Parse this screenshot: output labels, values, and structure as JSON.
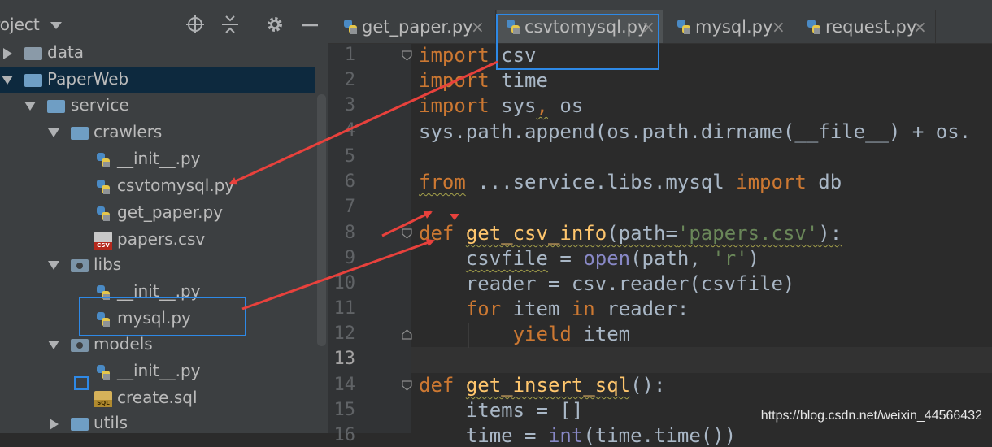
{
  "project": {
    "title": "roject",
    "tree": [
      {
        "label": "data",
        "type": "folder-data",
        "depth": 0,
        "expanded": false
      },
      {
        "label": "PaperWeb",
        "type": "folder",
        "depth": 0,
        "expanded": true,
        "selected": true
      },
      {
        "label": "service",
        "type": "folder",
        "depth": 1,
        "expanded": true
      },
      {
        "label": "crawlers",
        "type": "folder",
        "depth": 2,
        "expanded": true
      },
      {
        "label": "__init__.py",
        "type": "py",
        "depth": 3
      },
      {
        "label": "csvtomysql.py",
        "type": "py",
        "depth": 3
      },
      {
        "label": "get_paper.py",
        "type": "py",
        "depth": 3
      },
      {
        "label": "papers.csv",
        "type": "csv",
        "depth": 3
      },
      {
        "label": "libs",
        "type": "pkg",
        "depth": 2,
        "expanded": true
      },
      {
        "label": "__init__.py",
        "type": "py",
        "depth": 3
      },
      {
        "label": "mysql.py",
        "type": "py",
        "depth": 3
      },
      {
        "label": "models",
        "type": "pkg",
        "depth": 2,
        "expanded": true
      },
      {
        "label": "__init__.py",
        "type": "py",
        "depth": 3
      },
      {
        "label": "create.sql",
        "type": "sql",
        "depth": 3
      },
      {
        "label": "utils",
        "type": "folder",
        "depth": 2,
        "expanded": false
      }
    ]
  },
  "tabs": [
    {
      "label": "get_paper.py",
      "close": "×",
      "active": false
    },
    {
      "label": "csvtomysql.py",
      "close": "×",
      "active": true
    },
    {
      "label": "mysql.py",
      "close": "×",
      "active": false
    },
    {
      "label": "request.py",
      "close": "×",
      "active": false
    }
  ],
  "editor": {
    "current_line": 13,
    "line_numbers": [
      "1",
      "2",
      "3",
      "4",
      "5",
      "6",
      "7",
      "8",
      "9",
      "10",
      "11",
      "12",
      "13",
      "14",
      "15",
      "16"
    ],
    "lines": [
      [
        [
          "kw",
          "import"
        ],
        [
          "",
          "csv"
        ]
      ],
      [
        [
          "kw",
          "import"
        ],
        [
          "",
          "time"
        ]
      ],
      [
        [
          "kw",
          "import"
        ],
        [
          "",
          "sys"
        ],
        [
          "kw",
          ","
        ],
        [
          "",
          "os"
        ]
      ],
      [
        [
          "",
          "sys.path.append(os.path.dirname(__file__) + os."
        ]
      ],
      [],
      [
        [
          "kw-wavy",
          "from"
        ],
        [
          "",
          "...service.libs.mysql "
        ],
        [
          "kw",
          "import"
        ],
        [
          "",
          "db"
        ]
      ],
      [],
      [
        [
          "kw",
          "def"
        ],
        [
          "",
          "def-space"
        ],
        [
          "fn-wavy",
          "get_csv_info"
        ],
        [
          "",
          "(path="
        ],
        [
          "str",
          "'papers.csv'"
        ],
        [
          "",
          ")"
        ],
        [
          "",
          ":"
        ]
      ],
      [
        [
          "",
          "    "
        ],
        [
          "wavy",
          "csvfile"
        ],
        [
          "",
          ""
        ],
        [
          "",
          ""
        ]
      ],
      [
        [
          "",
          "    reader = csv.reader(csvfile)"
        ]
      ],
      [
        [
          "",
          "    "
        ],
        [
          "kw",
          "for"
        ],
        [
          "",
          " item "
        ],
        [
          "kw",
          "in"
        ],
        [
          "",
          " reader:"
        ]
      ],
      [
        [
          "",
          "        "
        ],
        [
          "kw",
          "yield"
        ],
        [
          "",
          " item"
        ]
      ],
      [],
      [
        [
          "kw",
          "def"
        ],
        [
          "",
          "def-space"
        ],
        [
          "fn-wavy",
          "get_insert_sql"
        ],
        [
          "",
          "():"
        ]
      ],
      [
        [
          "",
          "    items = []"
        ]
      ],
      [
        [
          "",
          "    time = int(time.time())"
        ]
      ]
    ]
  },
  "code_text": {
    "l1a": "import",
    "l1b": " csv",
    "l2a": "import",
    "l2b": " time",
    "l3a": "import",
    "l3b": " sys",
    "l3c": ",",
    "l3d": " os",
    "l4": "sys.path.append(os.path.dirname(__file__) + os.",
    "l6a": "from",
    "l6b": " ...service.libs.mysql ",
    "l6c": "import",
    "l6d": " db",
    "l8a": "def",
    "l8b": " ",
    "l8c": "get_csv_info",
    "l8d": "(path=",
    "l8e": "'papers.csv'",
    "l8f": "):",
    "l9a": "    ",
    "l9b": "csvfile",
    "l9c": " = ",
    "l9d": "open",
    "l9e": "(path, ",
    "l9f": "'r'",
    "l9g": ")",
    "l10": "    reader = csv.reader(csvfile)",
    "l11a": "    ",
    "l11b": "for",
    "l11c": " item ",
    "l11d": "in",
    "l11e": " reader:",
    "l12a": "        ",
    "l12b": "yield",
    "l12c": " item",
    "l14a": "def",
    "l14b": " ",
    "l14c": "get_insert_sql",
    "l14d": "():",
    "l15": "    items = []",
    "l16a": "    time = ",
    "l16b": "int",
    "l16c": "(time.time())"
  },
  "watermark": "https://blog.csdn.net/weixin_44566432",
  "colors": {
    "annotation_arrow": "#e8413c",
    "annotation_box": "#2e89e6",
    "keyword": "#cc7832",
    "function": "#ffc66d",
    "string": "#6a8759",
    "builtin": "#8888c6"
  }
}
